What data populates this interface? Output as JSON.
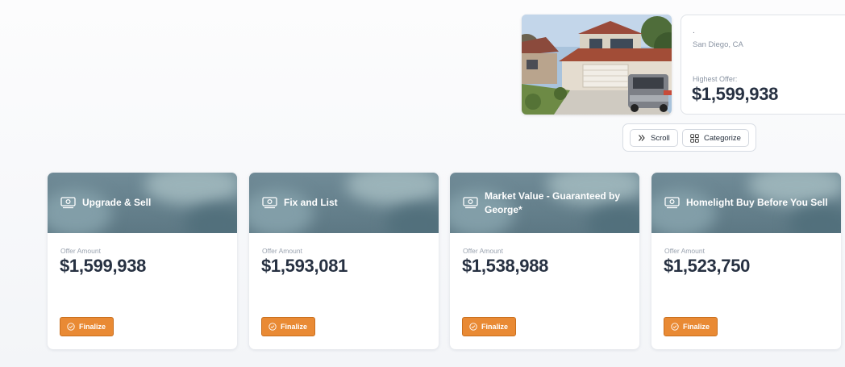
{
  "property": {
    "street": ".",
    "city": "San Diego, CA",
    "highest_offer_label": "Highest Offer:",
    "highest_offer_value": "$1,599,938"
  },
  "toolbar": {
    "scroll_label": "Scroll",
    "scroll_icon": "double-chevron-right-icon",
    "categorize_label": "Categorize",
    "categorize_icon": "grid-icon"
  },
  "offers": [
    {
      "title": "Upgrade & Sell",
      "label": "Offer Amount",
      "amount": "$1,599,938",
      "button": "Finalize"
    },
    {
      "title": "Fix and List",
      "label": "Offer Amount",
      "amount": "$1,593,081",
      "button": "Finalize"
    },
    {
      "title": "Market Value - Guaranteed by George*",
      "label": "Offer Amount",
      "amount": "$1,538,988",
      "button": "Finalize"
    },
    {
      "title": "Homelight Buy Before You Sell",
      "label": "Offer Amount",
      "amount": "$1,523,750",
      "button": "Finalize"
    }
  ],
  "colors": {
    "accent": "#e98a34",
    "card_header": "#6a8591",
    "price_text": "#273142"
  }
}
